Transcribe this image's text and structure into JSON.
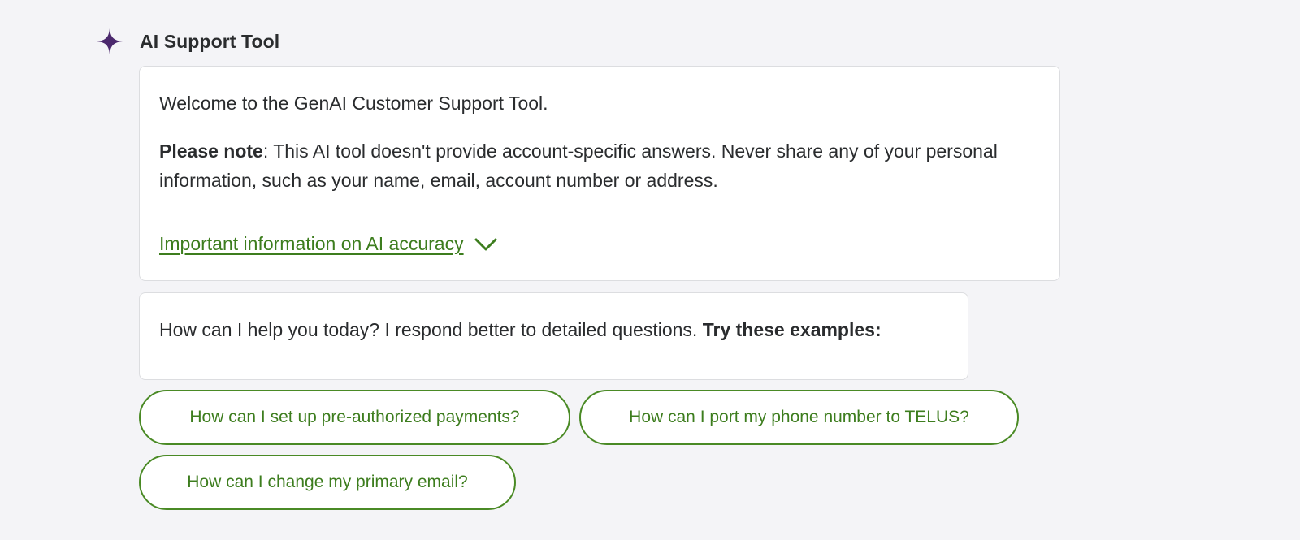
{
  "header": {
    "icon": "sparkle-icon",
    "title": "AI Support Tool"
  },
  "welcome": {
    "greeting": "Welcome to the GenAI Customer Support Tool.",
    "note_label": "Please note",
    "note_text": ": This AI tool doesn't provide account-specific answers. Never share any of your personal information, such as your name, email, account number or address.",
    "accuracy_link": "Important information on AI accuracy"
  },
  "help": {
    "prompt_text": "How can I help you today? I respond better to detailed questions. ",
    "prompt_bold": "Try these examples:"
  },
  "examples": [
    "How can I set up pre-authorized payments?",
    "How can I port my phone number to TELUS?",
    "How can I change my primary email?"
  ],
  "colors": {
    "accent_green": "#3d7d1e",
    "sparkle_purple": "#4b286d",
    "background": "#f4f4f7"
  }
}
